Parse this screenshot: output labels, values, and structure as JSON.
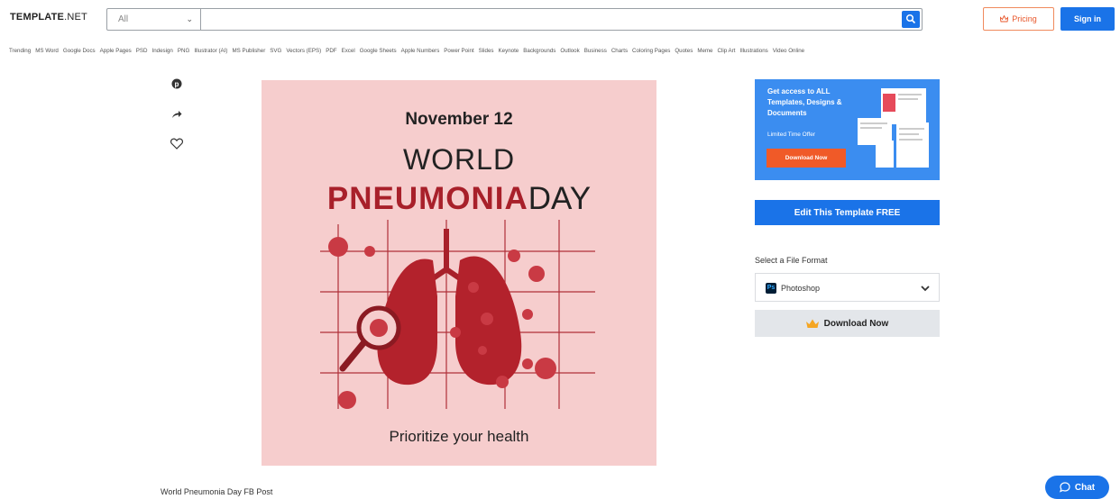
{
  "header": {
    "logo_main": "TEMPLATE",
    "logo_suffix": ".NET",
    "search_category": "All",
    "search_value": "",
    "pricing_label": "Pricing",
    "signin_label": "Sign in"
  },
  "categories": [
    "Trending",
    "MS Word",
    "Google Docs",
    "Apple Pages",
    "PSD",
    "Indesign",
    "PNG",
    "Illustrator (AI)",
    "MS Publisher",
    "SVG",
    "Vectors (EPS)",
    "PDF",
    "Excel",
    "Google Sheets",
    "Apple Numbers",
    "Power Point",
    "Slides",
    "Keynote",
    "Backgrounds",
    "Outlook",
    "Business",
    "Charts",
    "Coloring Pages",
    "Quotes",
    "Meme",
    "Clip Art",
    "Illustrations",
    "Video Online"
  ],
  "social": {
    "pinterest": "pinterest-icon",
    "share": "share-icon",
    "favorite": "heart-icon"
  },
  "poster": {
    "date": "November 12",
    "line1": "WORLD",
    "line2_highlight": "PNEUMONIA",
    "line2_rest": "DAY",
    "tagline": "Prioritize your health",
    "bg_color": "#f6cdcd",
    "accent_color": "#a8202a"
  },
  "caption": "World Pneumonia Day FB Post",
  "promo": {
    "headline": "Get access to ALL Templates, Designs & Documents",
    "offer": "Limited Time Offer",
    "button": "Download Now"
  },
  "edit_button": "Edit This Template FREE",
  "format": {
    "label": "Select a File Format",
    "selected": "Photoshop",
    "icon_text": "Ps"
  },
  "download_button": "Download Now",
  "chat_button": "Chat",
  "colors": {
    "primary": "#1a73e8",
    "orange": "#f05a28",
    "promo_bg": "#3b8df0"
  }
}
